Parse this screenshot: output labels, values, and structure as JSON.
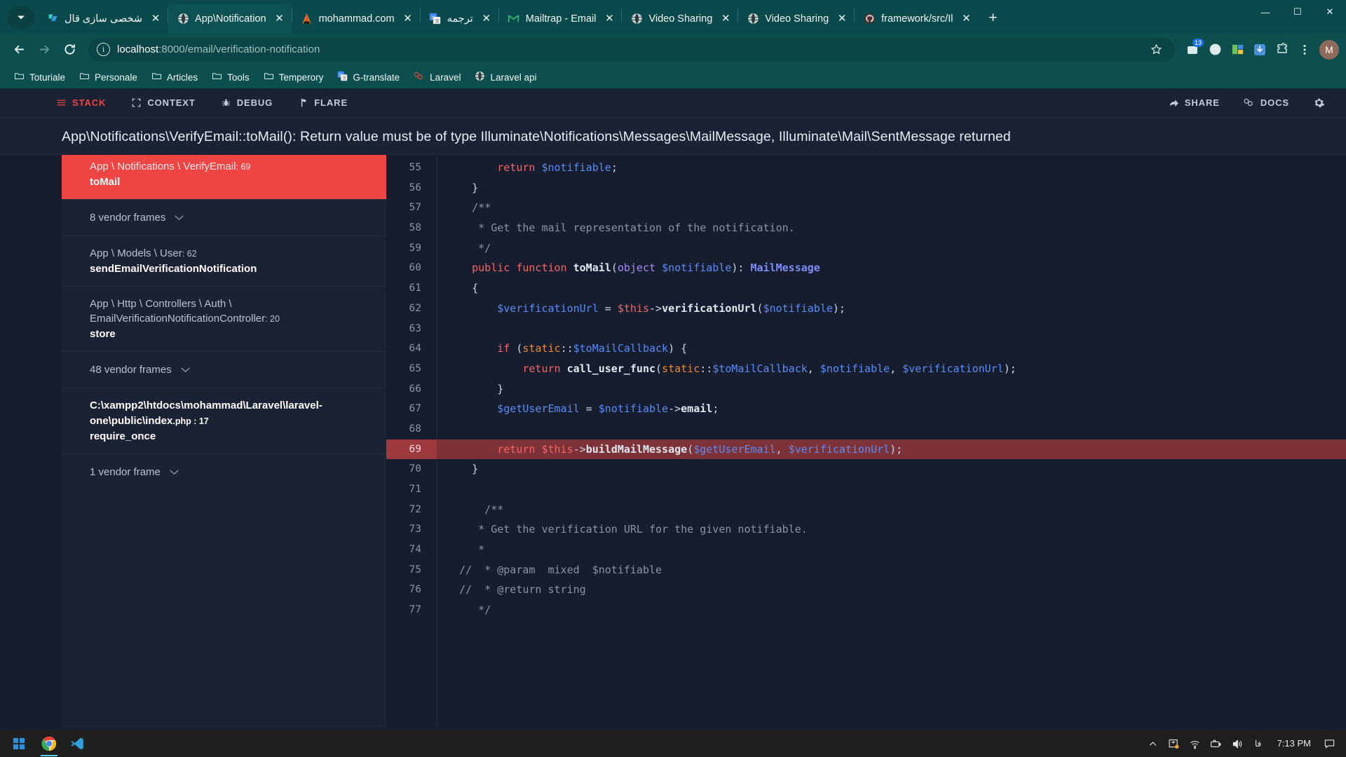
{
  "browser": {
    "tabs": [
      {
        "title": "شخصی سازی قال",
        "icon": "trello-icon",
        "rtl": true,
        "active": false
      },
      {
        "title": "App\\Notification",
        "icon": "globe-icon",
        "rtl": false,
        "active": true
      },
      {
        "title": "mohammad.com",
        "icon": "phpstorm-icon",
        "rtl": false,
        "active": false
      },
      {
        "title": "ترجمه",
        "icon": "google-translate-icon",
        "rtl": true,
        "active": false
      },
      {
        "title": "Mailtrap - Email",
        "icon": "gmail-icon",
        "rtl": false,
        "active": false
      },
      {
        "title": "Video Sharing",
        "icon": "globe-icon",
        "rtl": false,
        "active": false
      },
      {
        "title": "Video Sharing",
        "icon": "globe-icon",
        "rtl": false,
        "active": false
      },
      {
        "title": "framework/src/Il",
        "icon": "github-icon",
        "rtl": false,
        "active": false
      }
    ],
    "new_tab_label": "+",
    "window_controls": {
      "minimize": "—",
      "maximize": "☐",
      "close": "✕"
    },
    "toolbar": {
      "back": "back-arrow",
      "forward": "forward-arrow",
      "reload": "reload-arrow",
      "url_host": "localhost",
      "url_path": ":8000/email/verification-notification",
      "url_full": "localhost:8000/email/verification-notification",
      "extension_badge": "13",
      "profile_initial": "M"
    },
    "bookmarks": [
      {
        "label": "Toturiale",
        "icon": "folder-icon"
      },
      {
        "label": "Personale",
        "icon": "folder-icon"
      },
      {
        "label": "Articles",
        "icon": "folder-icon"
      },
      {
        "label": "Tools",
        "icon": "folder-icon"
      },
      {
        "label": "Temperory",
        "icon": "folder-icon"
      },
      {
        "label": "G-translate",
        "icon": "google-translate-icon"
      },
      {
        "label": "Laravel",
        "icon": "laravel-icon"
      },
      {
        "label": "Laravel api",
        "icon": "globe-icon"
      }
    ]
  },
  "ignition": {
    "nav_left": [
      {
        "label": "STACK",
        "icon": "stack-lines-icon",
        "active": true
      },
      {
        "label": "CONTEXT",
        "icon": "brackets-icon",
        "active": false
      },
      {
        "label": "DEBUG",
        "icon": "bug-icon",
        "active": false
      },
      {
        "label": "FLARE",
        "icon": "flare-icon",
        "active": false
      }
    ],
    "nav_right": [
      {
        "label": "SHARE",
        "icon": "share-arrow-icon"
      },
      {
        "label": "DOCS",
        "icon": "laravel-icon"
      }
    ],
    "settings_icon": "gear-icon",
    "error_title": "App\\Notifications\\VerifyEmail::toMail(): Return value must be of type Illuminate\\Notifications\\Messages\\MailMessage, Illuminate\\Mail\\SentMessage returned",
    "accent_color": "#ef4444",
    "frames": [
      {
        "type": "frame",
        "class": "App \\ Notifications \\ VerifyEmail",
        "line": ": 69",
        "method": "toMail",
        "selected": true
      },
      {
        "type": "vendor",
        "label": "8 vendor frames"
      },
      {
        "type": "frame",
        "class": "App \\ Models \\ User",
        "line": ": 62",
        "method": "sendEmailVerificationNotification",
        "selected": false
      },
      {
        "type": "frame",
        "class": "App \\ Http \\ Controllers \\ Auth \\ EmailVerificationNotificationController",
        "line": ": 20",
        "method": "store",
        "selected": false
      },
      {
        "type": "vendor",
        "label": "48 vendor frames"
      },
      {
        "type": "path",
        "class": "C:\\xampp2\\htdocs\\mohammad\\Laravel\\laravel-one\\public\\index",
        "line": ".php : 17",
        "method": "require_once",
        "selected": false
      },
      {
        "type": "vendor",
        "label": "1 vendor frame"
      }
    ],
    "code": {
      "highlighted_line": 69,
      "lines": [
        {
          "n": 55,
          "tokens": [
            {
              "t": "        ",
              "c": "pl"
            },
            {
              "t": "return",
              "c": "kw"
            },
            {
              "t": " ",
              "c": "pl"
            },
            {
              "t": "$notifiable",
              "c": "var"
            },
            {
              "t": ";",
              "c": "pl"
            }
          ]
        },
        {
          "n": 56,
          "tokens": [
            {
              "t": "    }",
              "c": "pl"
            }
          ]
        },
        {
          "n": 57,
          "tokens": [
            {
              "t": "    /**",
              "c": "cm"
            }
          ]
        },
        {
          "n": 58,
          "tokens": [
            {
              "t": "     * Get the mail representation of the notification.",
              "c": "cm"
            }
          ]
        },
        {
          "n": 59,
          "tokens": [
            {
              "t": "     */",
              "c": "cm"
            }
          ]
        },
        {
          "n": 60,
          "tokens": [
            {
              "t": "    ",
              "c": "pl"
            },
            {
              "t": "public function",
              "c": "kw"
            },
            {
              "t": " ",
              "c": "pl"
            },
            {
              "t": "toMail",
              "c": "fn"
            },
            {
              "t": "(",
              "c": "pl"
            },
            {
              "t": "object",
              "c": "mod"
            },
            {
              "t": " ",
              "c": "pl"
            },
            {
              "t": "$notifiable",
              "c": "var"
            },
            {
              "t": "): ",
              "c": "pl"
            },
            {
              "t": "MailMessage",
              "c": "type"
            }
          ]
        },
        {
          "n": 61,
          "tokens": [
            {
              "t": "    {",
              "c": "pl"
            }
          ]
        },
        {
          "n": 62,
          "tokens": [
            {
              "t": "        ",
              "c": "pl"
            },
            {
              "t": "$verificationUrl",
              "c": "var"
            },
            {
              "t": " = ",
              "c": "pl"
            },
            {
              "t": "$this",
              "c": "kw"
            },
            {
              "t": "->",
              "c": "pl"
            },
            {
              "t": "verificationUrl",
              "c": "fn"
            },
            {
              "t": "(",
              "c": "pl"
            },
            {
              "t": "$notifiable",
              "c": "var"
            },
            {
              "t": ");",
              "c": "pl"
            }
          ]
        },
        {
          "n": 63,
          "tokens": [
            {
              "t": "",
              "c": "pl"
            }
          ]
        },
        {
          "n": 64,
          "tokens": [
            {
              "t": "        ",
              "c": "pl"
            },
            {
              "t": "if",
              "c": "kw"
            },
            {
              "t": " (",
              "c": "pl"
            },
            {
              "t": "static",
              "c": "st"
            },
            {
              "t": "::",
              "c": "pl"
            },
            {
              "t": "$toMailCallback",
              "c": "var"
            },
            {
              "t": ") {",
              "c": "pl"
            }
          ]
        },
        {
          "n": 65,
          "tokens": [
            {
              "t": "            ",
              "c": "pl"
            },
            {
              "t": "return",
              "c": "kw"
            },
            {
              "t": " ",
              "c": "pl"
            },
            {
              "t": "call_user_func",
              "c": "fn"
            },
            {
              "t": "(",
              "c": "pl"
            },
            {
              "t": "static",
              "c": "st"
            },
            {
              "t": "::",
              "c": "pl"
            },
            {
              "t": "$toMailCallback",
              "c": "var"
            },
            {
              "t": ", ",
              "c": "pl"
            },
            {
              "t": "$notifiable",
              "c": "var"
            },
            {
              "t": ", ",
              "c": "pl"
            },
            {
              "t": "$verificationUrl",
              "c": "var"
            },
            {
              "t": ");",
              "c": "pl"
            }
          ]
        },
        {
          "n": 66,
          "tokens": [
            {
              "t": "        }",
              "c": "pl"
            }
          ]
        },
        {
          "n": 67,
          "tokens": [
            {
              "t": "        ",
              "c": "pl"
            },
            {
              "t": "$getUserEmail",
              "c": "var"
            },
            {
              "t": " = ",
              "c": "pl"
            },
            {
              "t": "$notifiable",
              "c": "var"
            },
            {
              "t": "->",
              "c": "pl"
            },
            {
              "t": "email",
              "c": "fn"
            },
            {
              "t": ";",
              "c": "pl"
            }
          ]
        },
        {
          "n": 68,
          "tokens": [
            {
              "t": "",
              "c": "pl"
            }
          ]
        },
        {
          "n": 69,
          "tokens": [
            {
              "t": "        ",
              "c": "pl"
            },
            {
              "t": "return",
              "c": "kw"
            },
            {
              "t": " ",
              "c": "pl"
            },
            {
              "t": "$this",
              "c": "kw"
            },
            {
              "t": "->",
              "c": "pl"
            },
            {
              "t": "buildMailMessage",
              "c": "fn"
            },
            {
              "t": "(",
              "c": "pl"
            },
            {
              "t": "$getUserEmail",
              "c": "var"
            },
            {
              "t": ", ",
              "c": "pl"
            },
            {
              "t": "$verificationUrl",
              "c": "var"
            },
            {
              "t": ");",
              "c": "pl"
            }
          ]
        },
        {
          "n": 70,
          "tokens": [
            {
              "t": "    }",
              "c": "pl"
            }
          ]
        },
        {
          "n": 71,
          "tokens": [
            {
              "t": "",
              "c": "pl"
            }
          ]
        },
        {
          "n": 72,
          "tokens": [
            {
              "t": "      /**",
              "c": "cm"
            }
          ]
        },
        {
          "n": 73,
          "tokens": [
            {
              "t": "     * Get the verification URL for the given notifiable.",
              "c": "cm"
            }
          ]
        },
        {
          "n": 74,
          "tokens": [
            {
              "t": "     *",
              "c": "cm"
            }
          ]
        },
        {
          "n": 75,
          "tokens": [
            {
              "t": "  //  * @param  mixed  $notifiable",
              "c": "cm"
            }
          ]
        },
        {
          "n": 76,
          "tokens": [
            {
              "t": "  //  * @return string",
              "c": "cm"
            }
          ]
        },
        {
          "n": 77,
          "tokens": [
            {
              "t": "     */",
              "c": "cm"
            }
          ]
        }
      ]
    }
  },
  "taskbar": {
    "start_icon": "windows-start-icon",
    "apps": [
      {
        "name": "chrome-icon",
        "active": true
      },
      {
        "name": "vscode-icon",
        "active": false
      }
    ],
    "tray": [
      {
        "icon": "chevron-up-icon"
      },
      {
        "icon": "onedrive-sync-icon"
      },
      {
        "icon": "wifi-icon"
      },
      {
        "icon": "battery-icon"
      },
      {
        "icon": "volume-icon"
      },
      {
        "icon": "language-indicator",
        "label": "فا"
      }
    ],
    "clock": "7:13 PM",
    "notification_icon": "notification-bubble-icon"
  }
}
